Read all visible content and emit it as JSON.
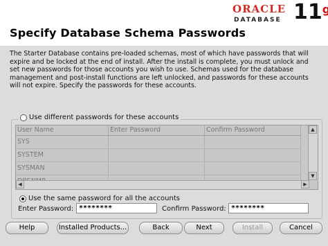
{
  "header": {
    "brand": "ORACLE",
    "product": "DATABASE",
    "version": "11",
    "version_suffix": "g"
  },
  "page": {
    "title": "Specify Database Schema Passwords",
    "description": "The Starter Database contains pre-loaded schemas, most of which have passwords that will expire and be locked at the end of install. After the install is complete, you must unlock and set new passwords for those accounts you wish to use. Schemas used for the database management and post-install functions are left unlocked, and passwords for these accounts will not expire. Specify the passwords for these accounts."
  },
  "options": {
    "different_label": "Use different passwords for these accounts",
    "same_label": "Use the same password for all the accounts",
    "selected": "same"
  },
  "table": {
    "headers": [
      "User Name",
      "Enter Password",
      "Confirm Password"
    ],
    "rows": [
      [
        "SYS",
        "",
        ""
      ],
      [
        "SYSTEM",
        "",
        ""
      ],
      [
        "SYSMAN",
        "",
        ""
      ],
      [
        "DBSNMP",
        "",
        ""
      ]
    ]
  },
  "fields": {
    "enter_label": "Enter Password:",
    "enter_value": "********",
    "confirm_label": "Confirm Password:",
    "confirm_value": "********"
  },
  "buttons": {
    "help": "Help",
    "installed_products": "Installed Products...",
    "back": "Back",
    "next": "Next",
    "install": "Install",
    "cancel": "Cancel"
  },
  "colors": {
    "background": "#dcdcdc",
    "brand_red": "#d32a22"
  }
}
